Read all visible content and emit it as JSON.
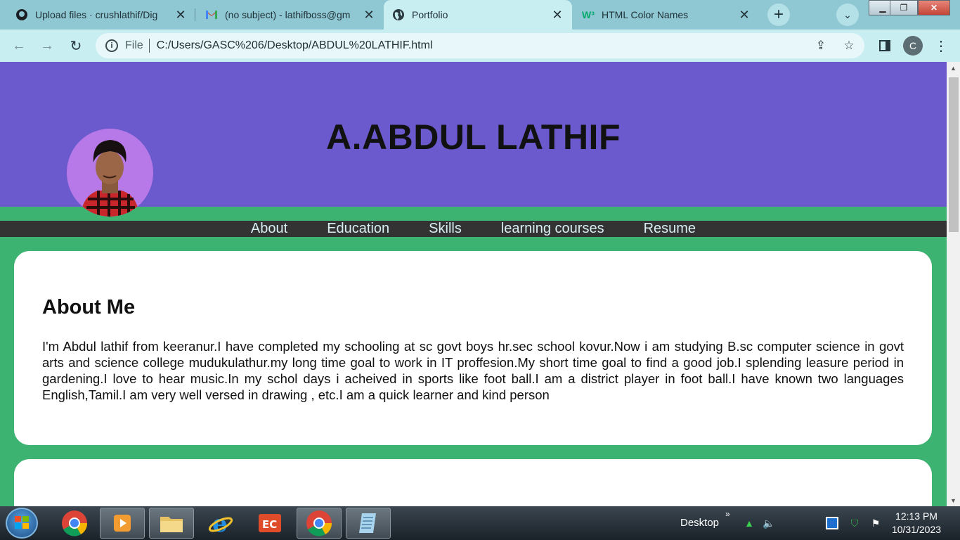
{
  "browser": {
    "tabs": [
      {
        "title": "Upload files · crushlathif/Dig",
        "icon": "github-icon",
        "active": false
      },
      {
        "title": "(no subject) - lathifboss@gm",
        "icon": "gmail-icon",
        "active": false
      },
      {
        "title": "Portfolio",
        "icon": "globe-icon",
        "active": true
      },
      {
        "title": "HTML Color Names",
        "icon": "w3schools-icon",
        "active": false
      }
    ],
    "address": {
      "scheme": "File",
      "url": "C:/Users/GASC%206/Desktop/ABDUL%20LATHIF.html"
    },
    "profile_initial": "C"
  },
  "page": {
    "name": "A.ABDUL LATHIF",
    "nav": [
      "About",
      "Education",
      "Skills",
      "learning courses",
      "Resume"
    ],
    "about": {
      "heading": "About Me",
      "text": "I'm Abdul lathif from keeranur.I have completed my schooling at sc govt boys hr.sec school kovur.Now i am studying B.sc computer science in govt arts and science college mudukulathur.my long time goal to work in IT proffesion.My short time goal to find a good job.I splending leasure period in gardening.I love to hear music.In my schol days i acheived in sports like foot ball.I am a district player in foot ball.I have known two languages English,Tamil.I am very well versed in drawing , etc.I am a quick learner and kind person"
    },
    "colors": {
      "header": "#6a5acd",
      "background": "#3cb371",
      "nav": "#333333"
    }
  },
  "taskbar": {
    "desktop_label": "Desktop",
    "time": "12:13 PM",
    "date": "10/31/2023"
  }
}
